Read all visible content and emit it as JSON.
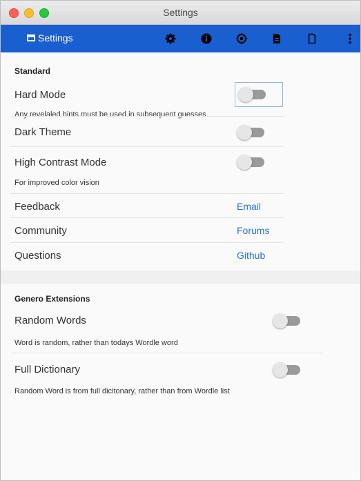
{
  "window": {
    "title": "Settings"
  },
  "toolbar": {
    "title": "Settings"
  },
  "sections": {
    "standard": {
      "header": "Standard",
      "hard_mode": {
        "label": "Hard Mode",
        "sub": "Any revelaled hints must be used in subsequent guesses",
        "on": false
      },
      "dark_theme": {
        "label": "Dark Theme",
        "on": false
      },
      "high_contrast": {
        "label": "High Contrast Mode",
        "sub": "For improved color vision",
        "on": false
      },
      "feedback": {
        "label": "Feedback",
        "link": "Email"
      },
      "community": {
        "label": "Community",
        "link": "Forums"
      },
      "questions": {
        "label": "Questions",
        "link": "Github"
      }
    },
    "genero": {
      "header": "Genero Extensions",
      "random_words": {
        "label": "Random Words",
        "sub": "Word is random, rather than todays Wordle word",
        "on": false
      },
      "full_dictionary": {
        "label": "Full Dictionary",
        "sub": "Random Word is from full dicitonary, rather than from Wordle list",
        "on": false
      }
    }
  },
  "colors": {
    "toolbar": "#1a5fd0",
    "link": "#2a6fd6"
  },
  "icons": [
    "gear-icon",
    "info-icon",
    "target-icon",
    "document-filled-icon",
    "document-outline-icon",
    "more-vertical-icon"
  ]
}
